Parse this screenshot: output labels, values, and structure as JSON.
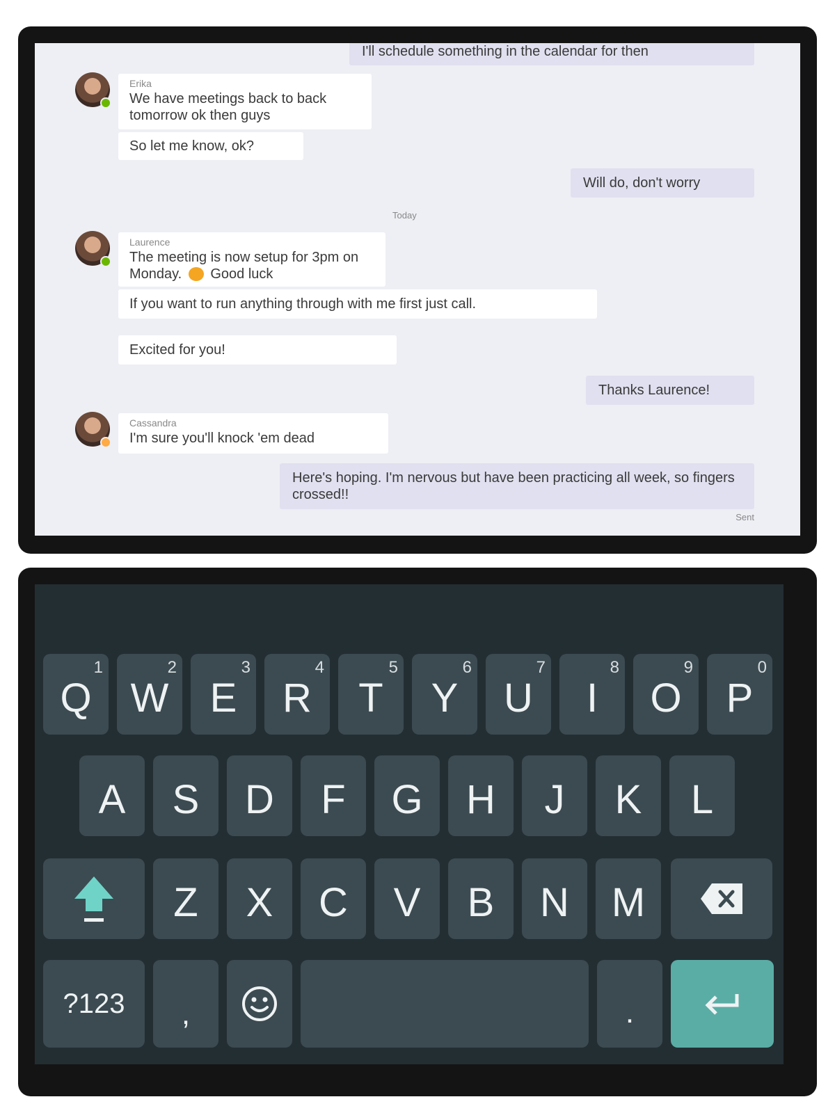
{
  "chat": {
    "messages": [
      {
        "side": "out",
        "text": "I'll schedule something in the calendar for then"
      },
      {
        "side": "in",
        "sender": "Erika",
        "text": "We have meetings back to back tomorrow ok then guys"
      },
      {
        "side": "in",
        "text": "So let me know, ok?"
      },
      {
        "side": "out",
        "text": "Will do, don't worry"
      },
      {
        "side": "in",
        "sender": "Laurence",
        "text": "The meeting is now setup for 3pm on Monday.",
        "text_after_emoji": "Good luck"
      },
      {
        "side": "in",
        "text": "If you want to run anything through with me first just call."
      },
      {
        "side": "in",
        "text": "Excited for you!"
      },
      {
        "side": "out",
        "text": "Thanks Laurence!"
      },
      {
        "side": "in",
        "sender": "Cassandra",
        "text": "I'm sure you'll knock 'em dead"
      },
      {
        "side": "out",
        "text": "Here's hoping. I'm nervous but have been practicing all week, so fingers crossed!!"
      }
    ],
    "day_separator": "Today",
    "sent_status": "Sent",
    "presence_colors": {
      "available": "#6bb700",
      "away": "#ffaa44"
    }
  },
  "keyboard": {
    "row1": [
      {
        "label": "Q",
        "hint": "1"
      },
      {
        "label": "W",
        "hint": "2"
      },
      {
        "label": "E",
        "hint": "3"
      },
      {
        "label": "R",
        "hint": "4"
      },
      {
        "label": "T",
        "hint": "5"
      },
      {
        "label": "Y",
        "hint": "6"
      },
      {
        "label": "U",
        "hint": "7"
      },
      {
        "label": "I",
        "hint": "8"
      },
      {
        "label": "O",
        "hint": "9"
      },
      {
        "label": "P",
        "hint": "0"
      }
    ],
    "row2": [
      "A",
      "S",
      "D",
      "F",
      "G",
      "H",
      "J",
      "K",
      "L"
    ],
    "row3": [
      "Z",
      "X",
      "C",
      "V",
      "B",
      "N",
      "M"
    ],
    "symbols_label": "?123",
    "comma_label": ",",
    "period_label": ".",
    "icons": {
      "shift": "shift-icon",
      "backspace": "backspace-icon",
      "emoji": "emoji-icon",
      "enter": "enter-icon"
    },
    "colors": {
      "background": "#232e33",
      "key": "#3c4b51",
      "accent": "#5aada5",
      "shift": "#6fd3c8"
    }
  }
}
